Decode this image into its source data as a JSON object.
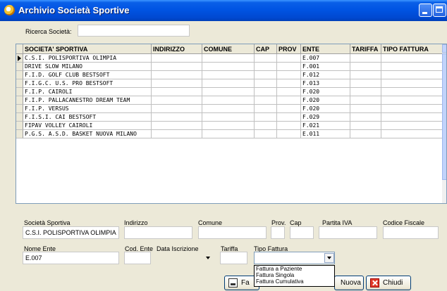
{
  "window": {
    "title": "Archivio Società Sportive"
  },
  "search": {
    "label": "Ricerca Società:",
    "value": ""
  },
  "grid": {
    "columns": [
      "SOCIETA' SPORTIVA",
      "INDIRIZZO",
      "COMUNE",
      "CAP",
      "PROV",
      "ENTE",
      "TARIFFA",
      "TIPO FATTURA"
    ],
    "rows": [
      [
        "C.S.I. POLISPORTIVA OLIMPIA",
        "",
        "",
        "",
        "",
        "E.007",
        "",
        ""
      ],
      [
        "DRIVE SLOW MILANO",
        "",
        "",
        "",
        "",
        "F.001",
        "",
        ""
      ],
      [
        "F.I.D. GOLF CLUB BESTSOFT",
        "",
        "",
        "",
        "",
        "F.012",
        "",
        ""
      ],
      [
        "F.I.G.C. U.S. PRO BESTSOFT",
        "",
        "",
        "",
        "",
        "F.013",
        "",
        ""
      ],
      [
        "F.I.P. CAIROLI",
        "",
        "",
        "",
        "",
        "F.020",
        "",
        ""
      ],
      [
        "F.I.P. PALLACANESTRO DREAM TEAM",
        "",
        "",
        "",
        "",
        "F.020",
        "",
        ""
      ],
      [
        "F.I.P. VERSUS",
        "",
        "",
        "",
        "",
        "F.020",
        "",
        ""
      ],
      [
        "F.I.S.I. CAI BESTSOFT",
        "",
        "",
        "",
        "",
        "F.029",
        "",
        ""
      ],
      [
        "FIPAV VOLLEY CAIROLI",
        "",
        "",
        "",
        "",
        "F.021",
        "",
        ""
      ],
      [
        "P.G.S. A.S.D. BASKET NUOVA MILANO",
        "",
        "",
        "",
        "",
        "E.011",
        "",
        ""
      ]
    ]
  },
  "form": {
    "societa_label": "Società Sportiva",
    "societa_value": "C.S.I. POLISPORTIVA OLIMPIA",
    "indirizzo_label": "Indirizzo",
    "comune_label": "Comune",
    "prov_label": "Prov.",
    "cap_label": "Cap",
    "piva_label": "Partita IVA",
    "cf_label": "Codice Fiscale",
    "ente_label": "Nome Ente",
    "ente_value": "E.007",
    "codente_label": "Cod. Ente",
    "data_label": "Data Iscrizione",
    "tariffa_label": "Tariffa",
    "tipo_label": "Tipo Fattura",
    "tipo_options": [
      "Fattura a Paziente",
      "Fattura Singola",
      "Fattura Cumulativa"
    ]
  },
  "buttons": {
    "print": "Fa",
    "nuova": "Nuova",
    "chiudi": "Chiudi"
  }
}
